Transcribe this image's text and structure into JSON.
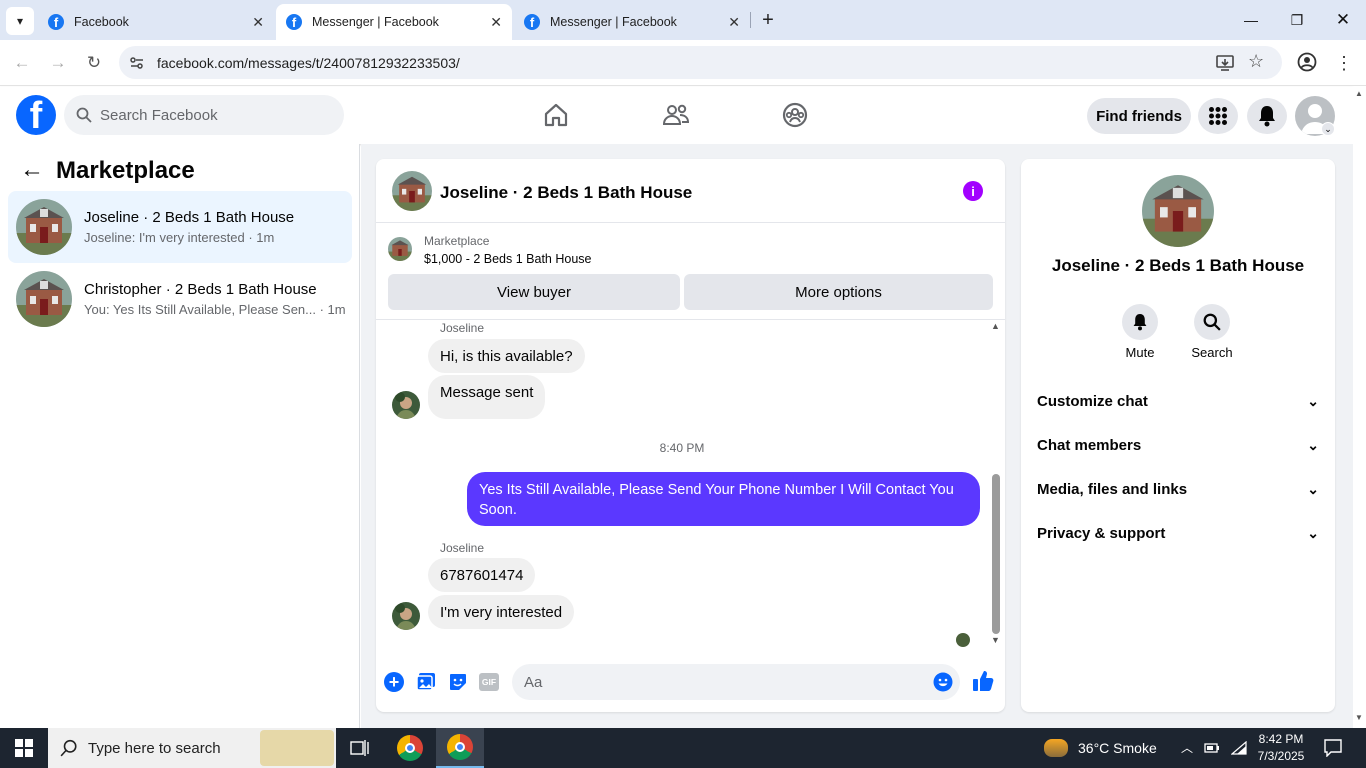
{
  "browser": {
    "tabs": [
      {
        "title": "Facebook",
        "active": false
      },
      {
        "title": "Messenger | Facebook",
        "active": true
      },
      {
        "title": "Messenger | Facebook",
        "active": false
      }
    ],
    "url": "facebook.com/messages/t/24007812932233503/"
  },
  "fb": {
    "search_placeholder": "Search Facebook",
    "find_friends": "Find friends"
  },
  "left": {
    "title": "Marketplace",
    "conversations": [
      {
        "name": "Joseline · 2 Beds 1 Bath House",
        "preview": "Joseline: I'm very interested · 1m",
        "active": true
      },
      {
        "name": "Christopher · 2 Beds 1 Bath House",
        "preview": "You: Yes Its Still Available, Please Sen... · 1m",
        "active": false
      }
    ]
  },
  "chat": {
    "title": "Joseline · 2 Beds 1 Bath House",
    "listing": {
      "source": "Marketplace",
      "price_line": "$1,000 - 2 Beds 1 Bath House",
      "view_buyer": "View buyer",
      "more_options": "More options"
    },
    "messages": {
      "sender1": "Joseline",
      "m1": "Hi, is this available?",
      "m2": "Message sent",
      "time": "8:40 PM",
      "out": "Yes Its Still Available, Please Send Your Phone Number I Will Contact You Soon.",
      "sender2": "Joseline",
      "m3": "6787601474",
      "m4": "I'm very interested"
    },
    "composer_placeholder": "Aa",
    "gif_label": "GIF"
  },
  "details": {
    "name": "Joseline · 2 Beds 1 Bath House",
    "mute": "Mute",
    "search": "Search",
    "sections": [
      "Customize chat",
      "Chat members",
      "Media, files and links",
      "Privacy & support"
    ]
  },
  "taskbar": {
    "search_placeholder": "Type here to search",
    "weather": "36°C  Smoke",
    "time": "8:42 PM",
    "date": "7/3/2025"
  },
  "colors": {
    "fb_blue": "#0866ff",
    "outgoing_bubble": "#5b38ff",
    "info_purple": "#a200ff",
    "active_conv": "#ebf5ff"
  }
}
